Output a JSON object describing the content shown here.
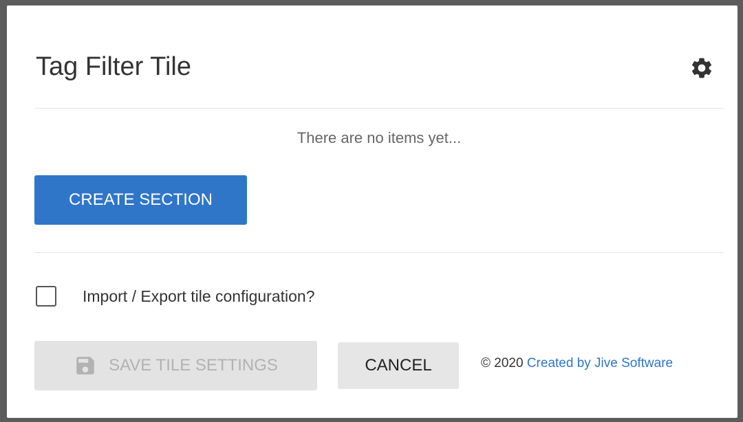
{
  "dialog": {
    "title": "Tag Filter Tile",
    "settings_icon": "gear-icon"
  },
  "content": {
    "empty_message": "There are no items yet...",
    "create_section_label": "CREATE SECTION"
  },
  "options": {
    "import_export_label": "Import / Export tile configuration?",
    "import_export_checked": false
  },
  "footer": {
    "save_label": "SAVE TILE SETTINGS",
    "save_icon": "floppy-disk-icon",
    "save_enabled": false,
    "cancel_label": "CANCEL",
    "copyright": "© 2020",
    "credit_link": "Created by Jive Software"
  },
  "colors": {
    "primary": "#2f76c9",
    "disabled_bg": "#e3e3e3",
    "disabled_text": "#b2b2b2",
    "backdrop": "#5c5c5c"
  }
}
